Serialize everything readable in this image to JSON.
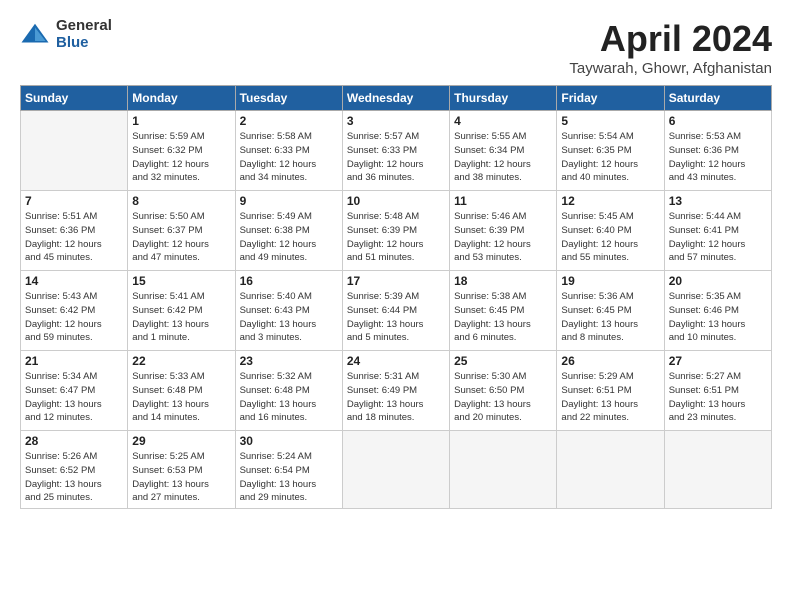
{
  "header": {
    "logo_general": "General",
    "logo_blue": "Blue",
    "title": "April 2024",
    "subtitle": "Taywarah, Ghowr, Afghanistan"
  },
  "days_of_week": [
    "Sunday",
    "Monday",
    "Tuesday",
    "Wednesday",
    "Thursday",
    "Friday",
    "Saturday"
  ],
  "weeks": [
    [
      {
        "num": "",
        "info": ""
      },
      {
        "num": "1",
        "info": "Sunrise: 5:59 AM\nSunset: 6:32 PM\nDaylight: 12 hours\nand 32 minutes."
      },
      {
        "num": "2",
        "info": "Sunrise: 5:58 AM\nSunset: 6:33 PM\nDaylight: 12 hours\nand 34 minutes."
      },
      {
        "num": "3",
        "info": "Sunrise: 5:57 AM\nSunset: 6:33 PM\nDaylight: 12 hours\nand 36 minutes."
      },
      {
        "num": "4",
        "info": "Sunrise: 5:55 AM\nSunset: 6:34 PM\nDaylight: 12 hours\nand 38 minutes."
      },
      {
        "num": "5",
        "info": "Sunrise: 5:54 AM\nSunset: 6:35 PM\nDaylight: 12 hours\nand 40 minutes."
      },
      {
        "num": "6",
        "info": "Sunrise: 5:53 AM\nSunset: 6:36 PM\nDaylight: 12 hours\nand 43 minutes."
      }
    ],
    [
      {
        "num": "7",
        "info": "Sunrise: 5:51 AM\nSunset: 6:36 PM\nDaylight: 12 hours\nand 45 minutes."
      },
      {
        "num": "8",
        "info": "Sunrise: 5:50 AM\nSunset: 6:37 PM\nDaylight: 12 hours\nand 47 minutes."
      },
      {
        "num": "9",
        "info": "Sunrise: 5:49 AM\nSunset: 6:38 PM\nDaylight: 12 hours\nand 49 minutes."
      },
      {
        "num": "10",
        "info": "Sunrise: 5:48 AM\nSunset: 6:39 PM\nDaylight: 12 hours\nand 51 minutes."
      },
      {
        "num": "11",
        "info": "Sunrise: 5:46 AM\nSunset: 6:39 PM\nDaylight: 12 hours\nand 53 minutes."
      },
      {
        "num": "12",
        "info": "Sunrise: 5:45 AM\nSunset: 6:40 PM\nDaylight: 12 hours\nand 55 minutes."
      },
      {
        "num": "13",
        "info": "Sunrise: 5:44 AM\nSunset: 6:41 PM\nDaylight: 12 hours\nand 57 minutes."
      }
    ],
    [
      {
        "num": "14",
        "info": "Sunrise: 5:43 AM\nSunset: 6:42 PM\nDaylight: 12 hours\nand 59 minutes."
      },
      {
        "num": "15",
        "info": "Sunrise: 5:41 AM\nSunset: 6:42 PM\nDaylight: 13 hours\nand 1 minute."
      },
      {
        "num": "16",
        "info": "Sunrise: 5:40 AM\nSunset: 6:43 PM\nDaylight: 13 hours\nand 3 minutes."
      },
      {
        "num": "17",
        "info": "Sunrise: 5:39 AM\nSunset: 6:44 PM\nDaylight: 13 hours\nand 5 minutes."
      },
      {
        "num": "18",
        "info": "Sunrise: 5:38 AM\nSunset: 6:45 PM\nDaylight: 13 hours\nand 6 minutes."
      },
      {
        "num": "19",
        "info": "Sunrise: 5:36 AM\nSunset: 6:45 PM\nDaylight: 13 hours\nand 8 minutes."
      },
      {
        "num": "20",
        "info": "Sunrise: 5:35 AM\nSunset: 6:46 PM\nDaylight: 13 hours\nand 10 minutes."
      }
    ],
    [
      {
        "num": "21",
        "info": "Sunrise: 5:34 AM\nSunset: 6:47 PM\nDaylight: 13 hours\nand 12 minutes."
      },
      {
        "num": "22",
        "info": "Sunrise: 5:33 AM\nSunset: 6:48 PM\nDaylight: 13 hours\nand 14 minutes."
      },
      {
        "num": "23",
        "info": "Sunrise: 5:32 AM\nSunset: 6:48 PM\nDaylight: 13 hours\nand 16 minutes."
      },
      {
        "num": "24",
        "info": "Sunrise: 5:31 AM\nSunset: 6:49 PM\nDaylight: 13 hours\nand 18 minutes."
      },
      {
        "num": "25",
        "info": "Sunrise: 5:30 AM\nSunset: 6:50 PM\nDaylight: 13 hours\nand 20 minutes."
      },
      {
        "num": "26",
        "info": "Sunrise: 5:29 AM\nSunset: 6:51 PM\nDaylight: 13 hours\nand 22 minutes."
      },
      {
        "num": "27",
        "info": "Sunrise: 5:27 AM\nSunset: 6:51 PM\nDaylight: 13 hours\nand 23 minutes."
      }
    ],
    [
      {
        "num": "28",
        "info": "Sunrise: 5:26 AM\nSunset: 6:52 PM\nDaylight: 13 hours\nand 25 minutes."
      },
      {
        "num": "29",
        "info": "Sunrise: 5:25 AM\nSunset: 6:53 PM\nDaylight: 13 hours\nand 27 minutes."
      },
      {
        "num": "30",
        "info": "Sunrise: 5:24 AM\nSunset: 6:54 PM\nDaylight: 13 hours\nand 29 minutes."
      },
      {
        "num": "",
        "info": ""
      },
      {
        "num": "",
        "info": ""
      },
      {
        "num": "",
        "info": ""
      },
      {
        "num": "",
        "info": ""
      }
    ]
  ]
}
